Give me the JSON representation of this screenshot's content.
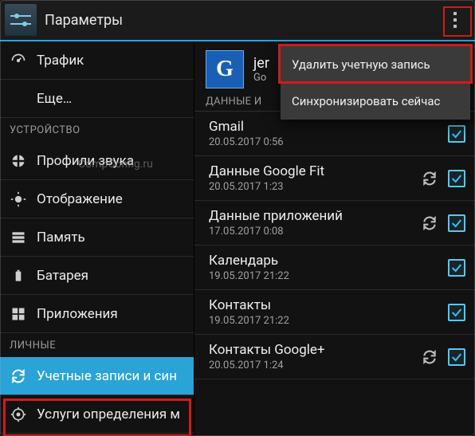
{
  "titlebar": {
    "title": "Параметры"
  },
  "watermark": "CompConfig.ru",
  "sidebar": {
    "items": [
      {
        "label": "Трафик"
      },
      {
        "label": "Еще…"
      }
    ],
    "header_device": "УСТРОЙСТВО",
    "device_items": [
      {
        "label": "Профили звука"
      },
      {
        "label": "Отображение"
      },
      {
        "label": "Память"
      },
      {
        "label": "Батарея"
      },
      {
        "label": "Приложения"
      }
    ],
    "header_personal": "ЛИЧНЫЕ",
    "personal_items": [
      {
        "label": "Учетные записи и син"
      },
      {
        "label": "Услуги определения м"
      }
    ]
  },
  "account": {
    "badge_letter": "G",
    "name": "jer",
    "sub": "Go",
    "section_title": "ДАННЫЕ И"
  },
  "sync": [
    {
      "label": "Gmail",
      "ts": "20.05.2017 0:56",
      "spinning": false,
      "checked": true
    },
    {
      "label": "Данные Google Fit",
      "ts": "20.05.2017 1:23",
      "spinning": true,
      "checked": true
    },
    {
      "label": "Данные приложений",
      "ts": "17.05.2017 0:08",
      "spinning": true,
      "checked": true
    },
    {
      "label": "Календарь",
      "ts": "19.05.2017 21:22",
      "spinning": false,
      "checked": true
    },
    {
      "label": "Контакты",
      "ts": "19.05.2017 21:22",
      "spinning": false,
      "checked": true
    },
    {
      "label": "Контакты Google+",
      "ts": "20.05.2017 1:24",
      "spinning": true,
      "checked": true
    }
  ],
  "popup": {
    "delete": "Удалить учетную запись",
    "sync_now": "Синхронизировать сейчас"
  }
}
